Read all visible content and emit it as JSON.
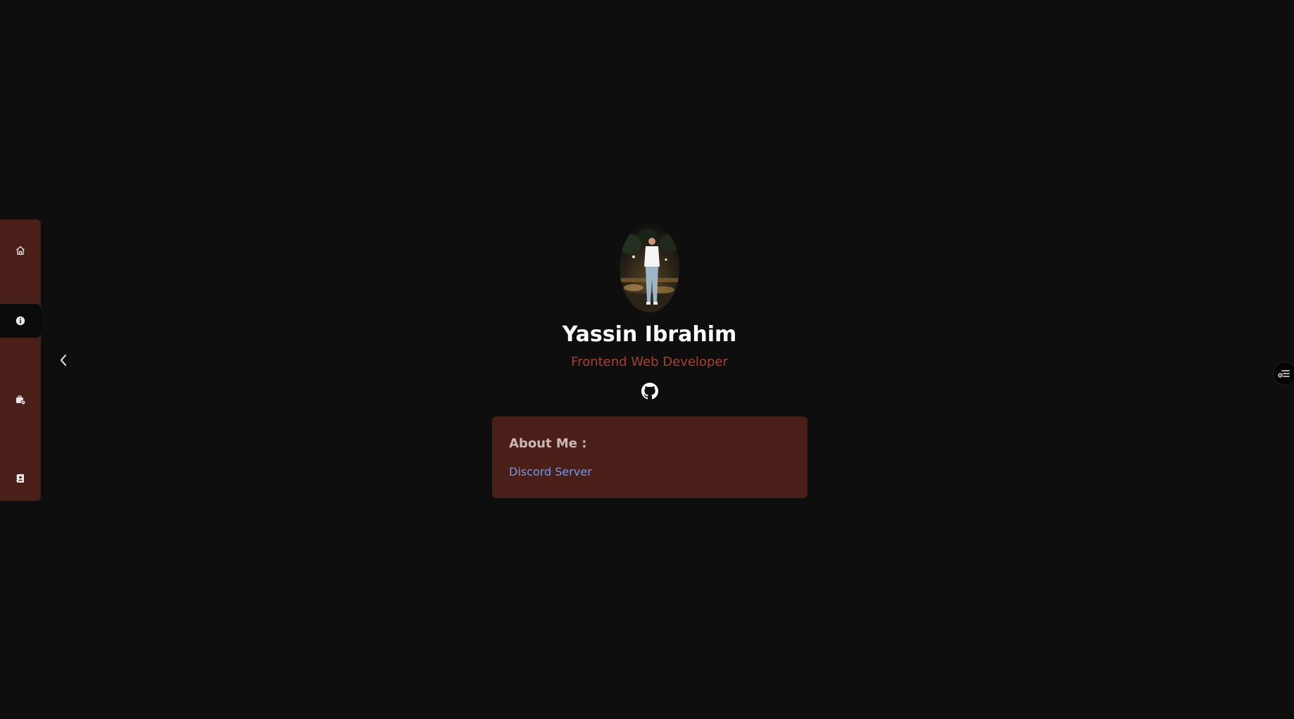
{
  "sidebar": {
    "items": [
      {
        "icon": "home-icon"
      },
      {
        "icon": "info-icon",
        "active": true
      },
      {
        "icon": "briefcase-icon"
      },
      {
        "icon": "contact-icon"
      }
    ]
  },
  "profile": {
    "name": "Yassin Ibrahim",
    "role": "Frontend Web Developer",
    "social_icon": "github-icon"
  },
  "about": {
    "title": "About Me :",
    "link_label": "Discord Server"
  },
  "colors": {
    "background": "#0e0e0e",
    "panel": "#4a1f1a",
    "accent": "#a9402f",
    "link": "#6f9ae8"
  }
}
